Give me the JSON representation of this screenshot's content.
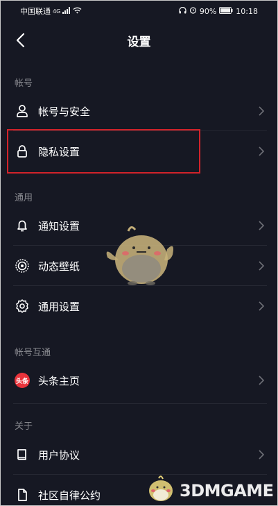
{
  "status_bar": {
    "carrier": "中国联通",
    "network": "4G",
    "battery": "90%",
    "time": "10:18"
  },
  "header": {
    "title": "设置"
  },
  "sections": [
    {
      "label": "帐号"
    },
    {
      "label": "通用"
    },
    {
      "label": "帐号互通"
    },
    {
      "label": "关于"
    }
  ],
  "rows": {
    "account_security": {
      "label": "帐号与安全",
      "icon": "user-icon"
    },
    "privacy": {
      "label": "隐私设置",
      "icon": "lock-icon"
    },
    "notifications": {
      "label": "通知设置",
      "icon": "bell-icon"
    },
    "wallpaper": {
      "label": "动态壁纸",
      "icon": "wallpaper-icon"
    },
    "general": {
      "label": "通用设置",
      "icon": "gear-icon"
    },
    "toutiao": {
      "label": "头条主页",
      "icon": "toutiao-icon",
      "icon_text": "头条"
    },
    "user_agreement": {
      "label": "用户协议",
      "icon": "book-icon"
    },
    "community": {
      "label": "社区自律公约",
      "icon": "document-icon"
    }
  },
  "watermark": {
    "text": "3DMGAME"
  },
  "colors": {
    "background": "#161823",
    "highlight": "#d2232a",
    "muted_text": "#8a8b91",
    "toutiao_red": "#e8333b"
  }
}
